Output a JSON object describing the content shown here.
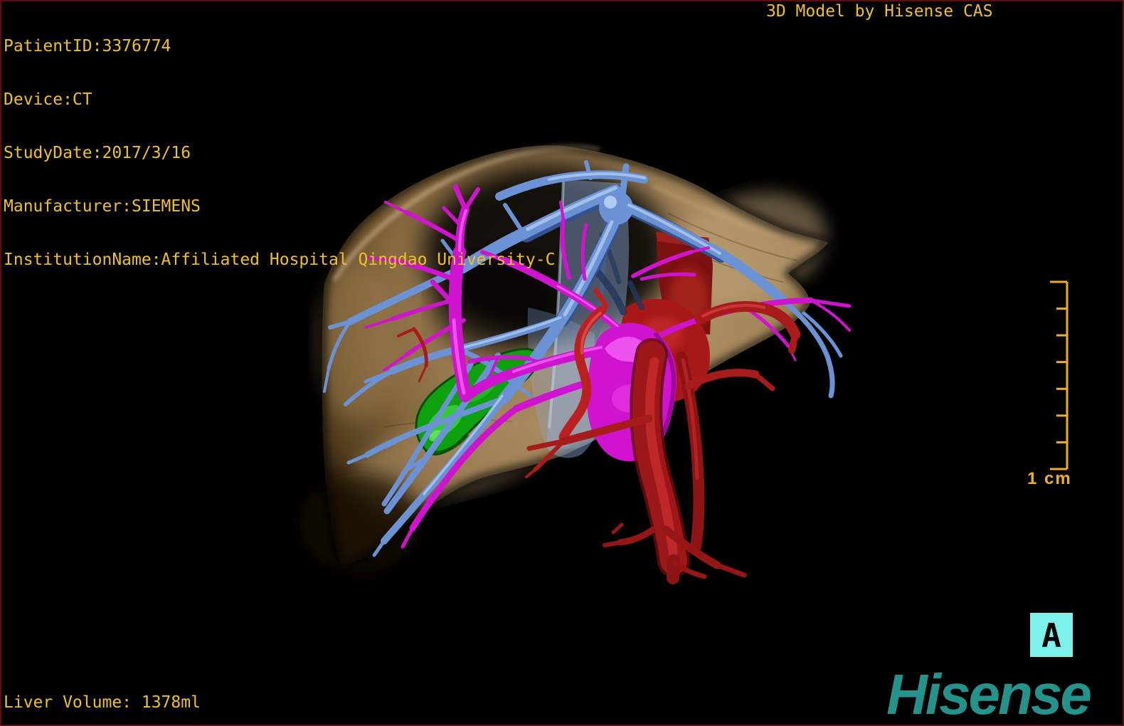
{
  "header": {
    "meta_lines": [
      "PatientID:3376774",
      "Device:CT",
      "StudyDate:2017/3/16",
      "Manufacturer:SIEMENS",
      "InstitutionName:Affiliated Hospital Qingdao University-C"
    ],
    "watermark": "3D Model by Hisense CAS"
  },
  "footer": {
    "volume_label": "Liver Volume: 1378ml",
    "logo_text": "Hisense"
  },
  "viewport": {
    "orientation_marker": "A",
    "scale_bar": {
      "label": "1 cm",
      "divisions": 7
    }
  },
  "model": {
    "structures": [
      {
        "name": "liver",
        "color": "#a3855a"
      },
      {
        "name": "hepatic-veins",
        "color": "#6b92d4"
      },
      {
        "name": "portal-vein",
        "color": "#cf13cf"
      },
      {
        "name": "hepatic-artery-aorta",
        "color": "#a51818"
      },
      {
        "name": "gallbladder",
        "color": "#0fa00f"
      },
      {
        "name": "inferior-vena-cava",
        "color": "#93b4e6"
      }
    ]
  },
  "colors": {
    "overlay_text": "#f0c02a",
    "scale_bar": "#edb01f",
    "orientation_bg": "#7df2ea",
    "logo": "#23938b",
    "frame_border": "#5a0e0e",
    "background": "#000000"
  }
}
